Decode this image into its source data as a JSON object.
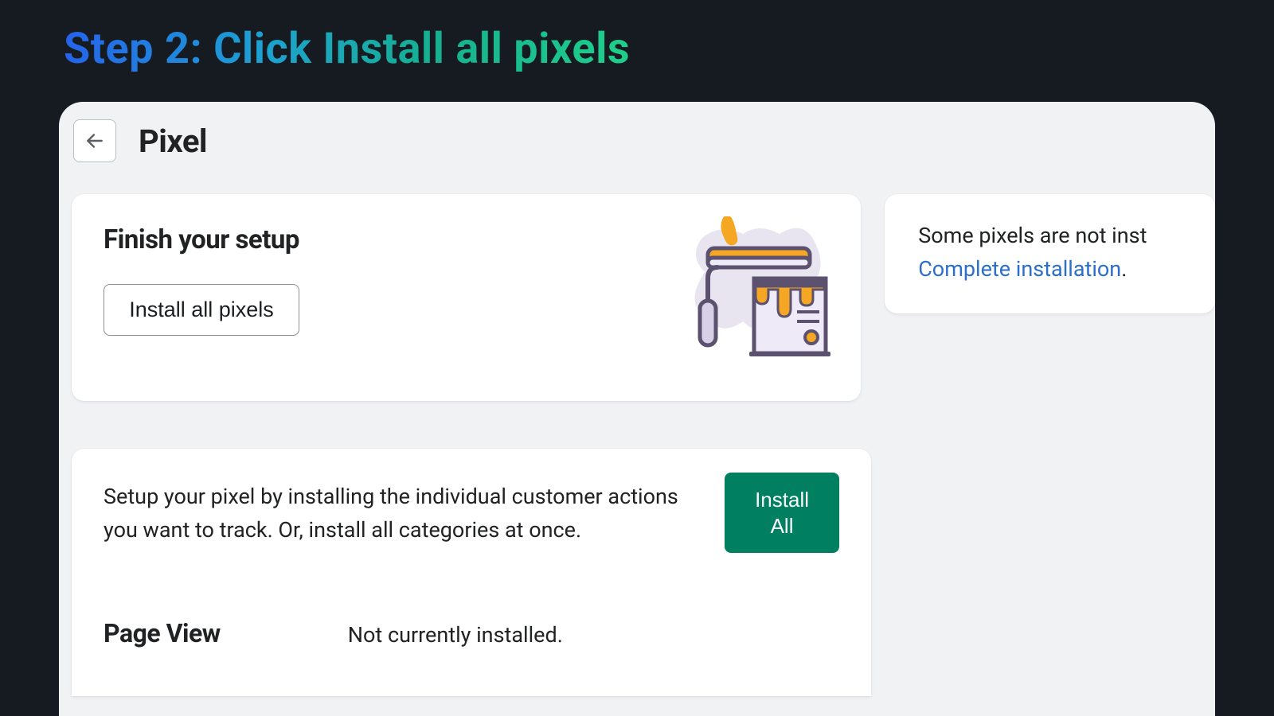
{
  "stepTitle": "Step 2: Click Install all pixels",
  "panel": {
    "title": "Pixel"
  },
  "setupCard": {
    "heading": "Finish your setup",
    "buttonLabel": "Install all pixels"
  },
  "sideCard": {
    "text": "Some pixels are not inst",
    "linkText": "Complete installation",
    "period": "."
  },
  "lowerCard": {
    "description": "Setup your pixel by installing the individual customer actions you want to track. Or, install all categories at once.",
    "installAllLine1": "Install",
    "installAllLine2": "All",
    "pageViewLabel": "Page View",
    "pageViewStatus": "Not currently installed."
  }
}
